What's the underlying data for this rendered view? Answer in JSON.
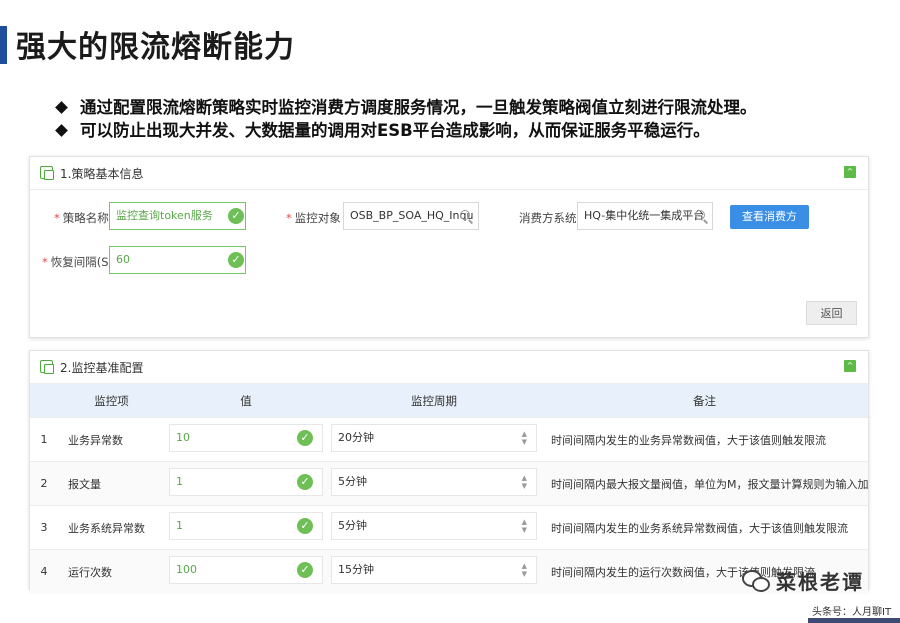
{
  "slide": {
    "title": "强大的限流熔断能力",
    "bullets": [
      "通过配置限流熔断策略实时监控消费方调度服务情况，一旦触发策略阀值立刻进行限流处理。",
      "可以防止出现大并发、大数据量的调用对ESB平台造成影响，从而保证服务平稳运行。"
    ]
  },
  "panel1": {
    "title": "1.策略基本信息",
    "required_mark": "*",
    "policy_name_label": "策略名称",
    "policy_name_value": "监控查询token服务",
    "monitor_target_label": "监控对象",
    "monitor_target_value": "OSB_BP_SOA_HQ_Inqu",
    "consumer_label": "消费方系统",
    "consumer_value": "HQ-集中化统一集成平台",
    "view_consumer_button": "查看消费方",
    "recovery_label": "恢复间隔(S)",
    "recovery_value": "60",
    "back_button": "返回"
  },
  "panel2": {
    "title": "2.监控基准配置",
    "columns": [
      "监控项",
      "值",
      "监控周期",
      "备注"
    ],
    "rows": [
      {
        "no": "1",
        "item": "业务异常数",
        "value": "10",
        "period": "20分钟",
        "note": "时间间隔内发生的业务异常数阀值，大于该值则触发限流"
      },
      {
        "no": "2",
        "item": "报文量",
        "value": "1",
        "period": "5分钟",
        "note": "时间间隔内最大报文量阀值，单位为M，报文量计算规则为输入加输出总的"
      },
      {
        "no": "3",
        "item": "业务系统异常数",
        "value": "1",
        "period": "5分钟",
        "note": "时间间隔内发生的业务系统异常数阀值，大于该值则触发限流"
      },
      {
        "no": "4",
        "item": "运行次数",
        "value": "100",
        "period": "15分钟",
        "note": "时间间隔内发生的运行次数阀值，大于该值则触发限流"
      }
    ]
  },
  "watermark": {
    "name": "菜根老谭",
    "sub": "头条号：人月聊IT"
  },
  "colors": {
    "accent_blue": "#3a8ee6",
    "title_bar": "#1f4e9c",
    "ok_green": "#6fbf57",
    "header_bg": "#e8f1fb"
  },
  "icons": {
    "panel_header": "window-icon",
    "collapse": "collapse-icon",
    "valid": "check-circle-icon",
    "search": "search-icon",
    "spinner": "spinner-icon"
  }
}
